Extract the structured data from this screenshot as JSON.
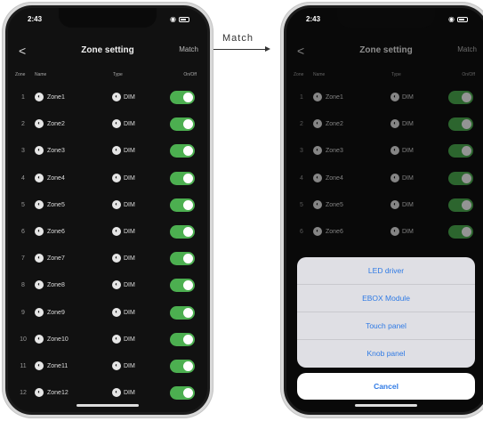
{
  "colors": {
    "toggle_on": "#4caf50",
    "sheet_text": "#2f7ae5"
  },
  "left": {
    "time": "2:43",
    "title": "Zone setting",
    "match": "Match",
    "back": "<",
    "columns": {
      "zone": "Zone",
      "name": "Name",
      "type": "Type",
      "onoff": "On/Off"
    },
    "rows": [
      {
        "num": "1",
        "name": "Zone1",
        "type": "DIM"
      },
      {
        "num": "2",
        "name": "Zone2",
        "type": "DIM"
      },
      {
        "num": "3",
        "name": "Zone3",
        "type": "DIM"
      },
      {
        "num": "4",
        "name": "Zone4",
        "type": "DIM"
      },
      {
        "num": "5",
        "name": "Zone5",
        "type": "DIM"
      },
      {
        "num": "6",
        "name": "Zone6",
        "type": "DIM"
      },
      {
        "num": "7",
        "name": "Zone7",
        "type": "DIM"
      },
      {
        "num": "8",
        "name": "Zone8",
        "type": "DIM"
      },
      {
        "num": "9",
        "name": "Zone9",
        "type": "DIM"
      },
      {
        "num": "10",
        "name": "Zone10",
        "type": "DIM"
      },
      {
        "num": "11",
        "name": "Zone11",
        "type": "DIM"
      },
      {
        "num": "12",
        "name": "Zone12",
        "type": "DIM"
      }
    ]
  },
  "arrow": {
    "label": "Match"
  },
  "right": {
    "time": "2:43",
    "title": "Zone setting",
    "match": "Match",
    "back": "<",
    "columns": {
      "zone": "Zone",
      "name": "Name",
      "type": "Type",
      "onoff": "On/Off"
    },
    "rows": [
      {
        "num": "1",
        "name": "Zone1",
        "type": "DIM"
      },
      {
        "num": "2",
        "name": "Zone2",
        "type": "DIM"
      },
      {
        "num": "3",
        "name": "Zone3",
        "type": "DIM"
      },
      {
        "num": "4",
        "name": "Zone4",
        "type": "DIM"
      },
      {
        "num": "5",
        "name": "Zone5",
        "type": "DIM"
      },
      {
        "num": "6",
        "name": "Zone6",
        "type": "DIM"
      }
    ],
    "sheet": {
      "options": [
        "LED driver",
        "EBOX Module",
        "Touch panel",
        "Knob panel"
      ],
      "cancel": "Cancel"
    }
  }
}
